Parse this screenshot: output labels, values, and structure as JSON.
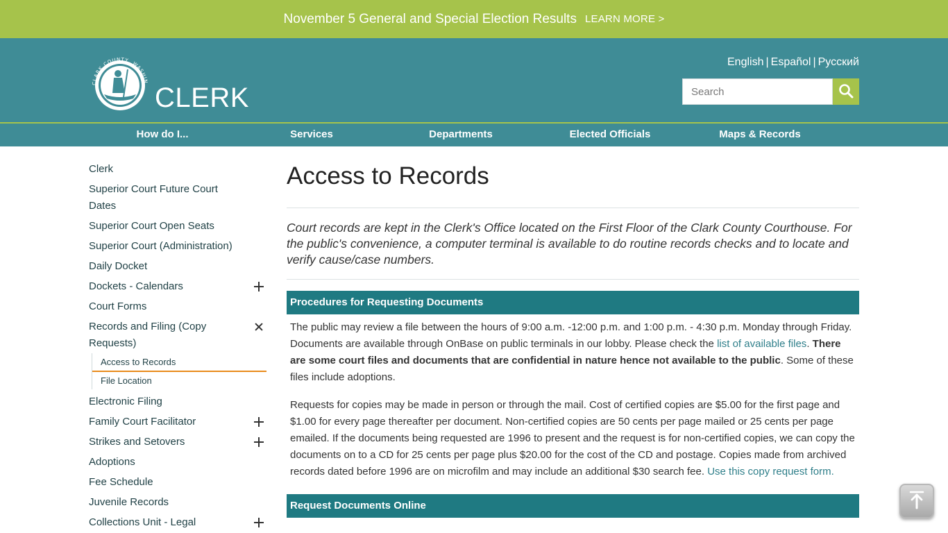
{
  "alert": {
    "title": "November 5 General and Special Election Results",
    "link": "LEARN MORE >"
  },
  "header": {
    "site_name": "CLERK",
    "logo_text": "CLARK COUNTY, WASHINGTON",
    "languages": [
      "English",
      "Español",
      "Русский"
    ],
    "search_placeholder": "Search"
  },
  "nav": {
    "items": [
      "How do I...",
      "Services",
      "Departments",
      "Elected Officials",
      "Maps & Records"
    ]
  },
  "sidebar": {
    "items": [
      {
        "label": "Clerk",
        "toggle": "none"
      },
      {
        "label": "Superior Court Future Court Dates",
        "toggle": "none"
      },
      {
        "label": "Superior Court Open Seats",
        "toggle": "none"
      },
      {
        "label": "Superior Court (Administration)",
        "toggle": "none"
      },
      {
        "label": "Daily Docket",
        "toggle": "none"
      },
      {
        "label": "Dockets - Calendars",
        "toggle": "plus"
      },
      {
        "label": "Court Forms",
        "toggle": "none"
      },
      {
        "label": "Records and Filing (Copy Requests)",
        "toggle": "close"
      },
      {
        "label": "Electronic Filing",
        "toggle": "none"
      },
      {
        "label": "Family Court Facilitator",
        "toggle": "plus"
      },
      {
        "label": "Strikes and Setovers",
        "toggle": "plus"
      },
      {
        "label": "Adoptions",
        "toggle": "none"
      },
      {
        "label": "Fee Schedule",
        "toggle": "none"
      },
      {
        "label": "Juvenile Records",
        "toggle": "none"
      },
      {
        "label": "Collections Unit - Legal Financial Obligations (LFO)",
        "toggle": "plus"
      }
    ],
    "sub_items": [
      {
        "label": "Access to Records",
        "active": true
      },
      {
        "label": "File Location",
        "active": false
      }
    ]
  },
  "content": {
    "title": "Access to Records",
    "intro": "Court records are kept in the Clerk's Office located on the First Floor of the Clark County Courthouse. For the public's convenience, a computer terminal is available to do routine records checks and to locate and verify cause/case numbers.",
    "section1": {
      "heading": "Procedures for Requesting Documents",
      "p1_text_a": "The public may review a file between the hours of 9:00 a.m. -12:00 p.m. and 1:00 p.m. - 4:30 p.m. Monday through Friday. Documents are available through OnBase on public terminals in our lobby. Please check the ",
      "p1_link": "list of available files",
      "p1_text_b": ". ",
      "p1_bold": "There are some court files and documents that are confidential in nature hence not available to the public",
      "p1_text_c": ". Some of these files include adoptions.",
      "p2_text": "Requests for copies may be made in person or through the mail. Cost of certified copies are $5.00 for the first page and $1.00 for every page thereafter per document. Non-certified copies are 50 cents per page mailed or 25 cents per page emailed. If the documents being requested are 1996 to present and the request is for non-certified copies, we can copy the documents on to a CD for 25 cents per page plus $20.00 for the cost of the CD and postage. Copies made from archived records dated before 1996 are on microfilm and may include an additional $30 search fee. ",
      "p2_link": "Use this copy request form."
    },
    "section2": {
      "heading": "Request Documents Online"
    }
  },
  "colors": {
    "banner": "#a6c34b",
    "header": "#3f8c96",
    "section_head": "#1f7a82",
    "active_underline": "#e88a1a"
  },
  "icons": {
    "search": "search-icon",
    "back_to_top": "arrow-up-to-line-icon"
  }
}
